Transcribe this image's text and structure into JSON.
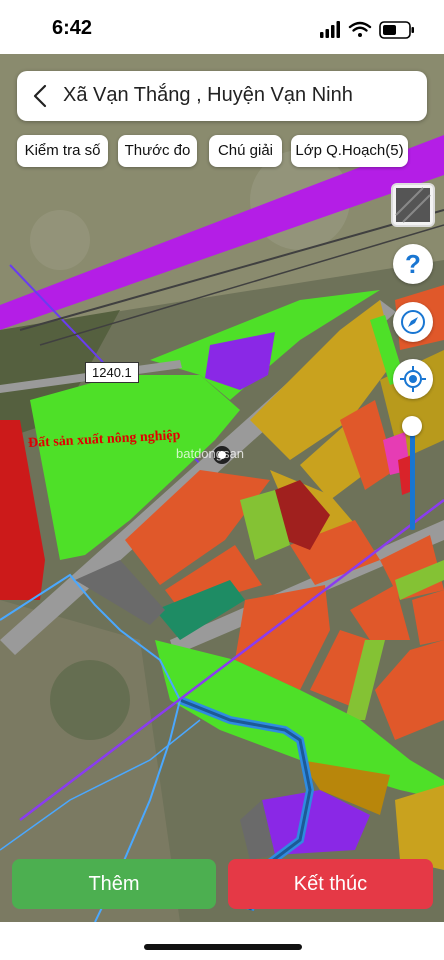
{
  "status_bar": {
    "time": "6:42",
    "icons": [
      "signal-icon",
      "wifi-icon",
      "battery-icon"
    ]
  },
  "search": {
    "back_icon": "chevron-left-icon",
    "location_text": "Xã Vạn Thắng , Huyện Vạn Ninh"
  },
  "toolbar": {
    "check_number": "Kiểm tra số",
    "ruler": "Thước đo",
    "legend": "Chú giải",
    "planning_layer": "Lớp Q.Hoạch(5)"
  },
  "side_controls": {
    "layers_icon": "layers-icon",
    "help_icon": "question-icon",
    "compass_icon": "compass-icon",
    "locate_icon": "locate-icon",
    "zoom_level": 0.2
  },
  "map": {
    "zone_label": "Đất sản xuất nông nghiệp",
    "parcel_label": "1240.1",
    "watermark": "batdongsan"
  },
  "actions": {
    "add_label": "Thêm",
    "finish_label": "Kết thúc"
  },
  "colors": {
    "add_button": "#4caf50",
    "finish_button": "#e53946",
    "agri_green": "#5ce632",
    "residential_orange": "#e65a28",
    "commercial_yellow": "#c8a21e",
    "industrial_purple": "#8a28e6",
    "road_gray": "#8c8c8c",
    "river_blue": "#4aa8ff"
  }
}
